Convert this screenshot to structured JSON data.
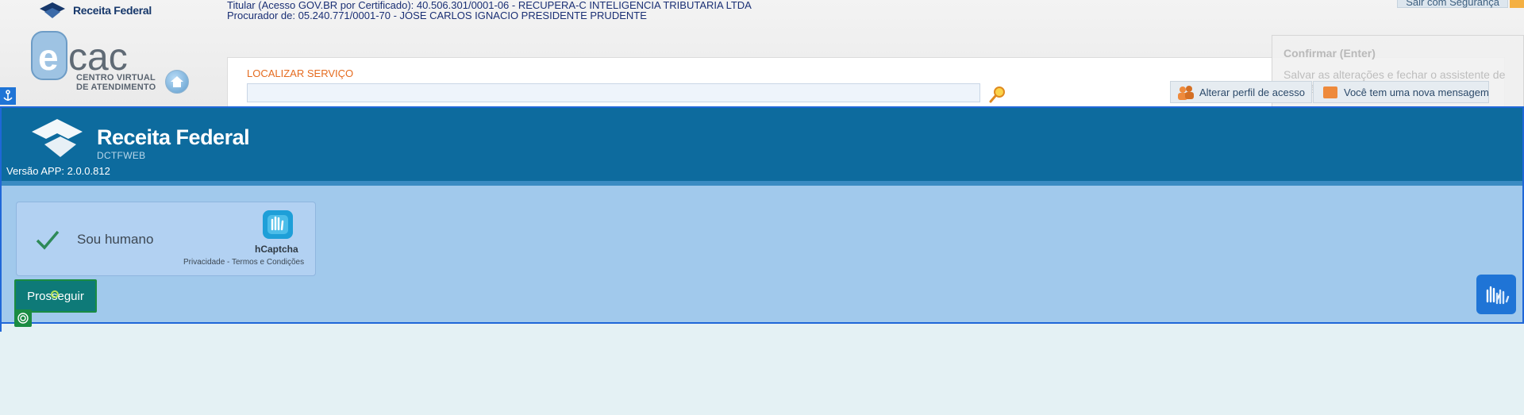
{
  "ecac": {
    "brand_top": "Receita Federal",
    "logo_text": "cac",
    "logo_sub_line1": "CENTRO VIRTUAL",
    "logo_sub_line2": "DE ATENDIMENTO",
    "titular_line1": "Titular (Acesso GOV.BR por Certificado): 40.506.301/0001-06 - RECUPERA-C INTELIGENCIA TRIBUTARIA LTDA",
    "titular_line2": "Procurador de: 05.240.771/0001-70 - JOSE CARLOS IGNACIO PRESIDENTE PRUDENTE",
    "logout_label": "Sair com Segurança",
    "search": {
      "label": "LOCALIZAR SERVIÇO",
      "value": "",
      "placeholder": ""
    },
    "alter_profile_label": "Alterar perfil de acesso",
    "new_message_label": "Você tem uma nova mensagem"
  },
  "tooltip": {
    "title": "Confirmar (Enter)",
    "body": "Salvar as alterações e fechar o assistente de seleção."
  },
  "dctfweb": {
    "brand_name": "Receita Federal",
    "brand_sub": "DCTFWEB",
    "version_label": "Versão APP: 2.0.0.812",
    "captcha": {
      "label": "Sou humano",
      "provider": "hCaptcha",
      "links": "Privacidade - Termos e Condições"
    },
    "proceed_label": "Prosseguir"
  },
  "colors": {
    "banner": "#0d6b9e",
    "frame_bg": "#a1c9ec",
    "accent_orange": "#e56b1f",
    "proceed_bg": "#0e7a78",
    "frame_border": "#1f67d8"
  }
}
